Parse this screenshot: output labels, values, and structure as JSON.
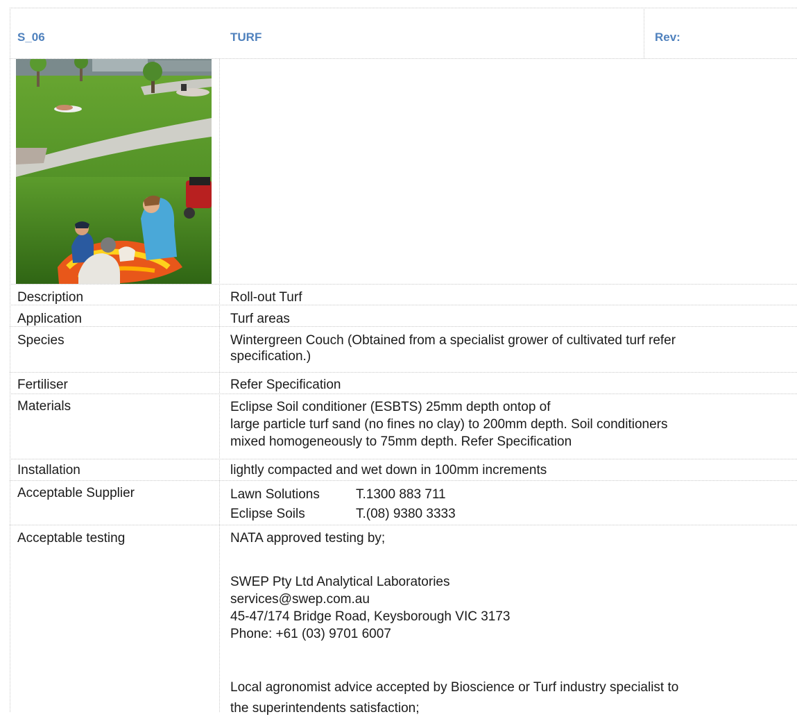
{
  "header": {
    "code": "S_06",
    "title": "TURF",
    "rev_label": "Rev:"
  },
  "photo": {
    "icon": "park-turf-photo"
  },
  "rows": {
    "description": {
      "label": "Description",
      "value": "Roll-out Turf"
    },
    "application": {
      "label": "Application",
      "value": "Turf areas"
    },
    "species": {
      "label": "Species",
      "lines": [
        "Wintergreen Couch (Obtained from a specialist grower of cultivated turf refer",
        "specification.)"
      ]
    },
    "fertiliser": {
      "label": "Fertiliser",
      "value": "Refer Specification"
    },
    "materials": {
      "label": "Materials",
      "lines": [
        "Eclipse Soil conditioner (ESBTS) 25mm depth ontop of",
        "large particle turf sand (no fines no clay) to 200mm depth. Soil conditioners",
        "mixed homogeneously to 75mm depth. Refer Specification"
      ]
    },
    "installation": {
      "label": "Installation",
      "value": "lightly compacted and wet down in 100mm increments"
    },
    "supplier": {
      "label": "Acceptable Supplier",
      "entries": [
        {
          "name": "Lawn Solutions",
          "phone": "T.1300 883 711"
        },
        {
          "name": "Eclipse Soils",
          "phone": "T.(08) 9380 3333"
        }
      ]
    },
    "testing": {
      "label": "Acceptable testing",
      "intro": "NATA approved testing by;",
      "lab_name": "SWEP Pty Ltd Analytical Laboratories",
      "email": "services@swep.com.au",
      "address": "45-47/174 Bridge Road, Keysborough VIC 3173",
      "phone": "Phone: +61 (03) 9701 6007",
      "note_lines": [
        "Local agronomist advice accepted by Bioscience or Turf industry specialist to",
        "the superintendents satisfaction;"
      ]
    }
  }
}
